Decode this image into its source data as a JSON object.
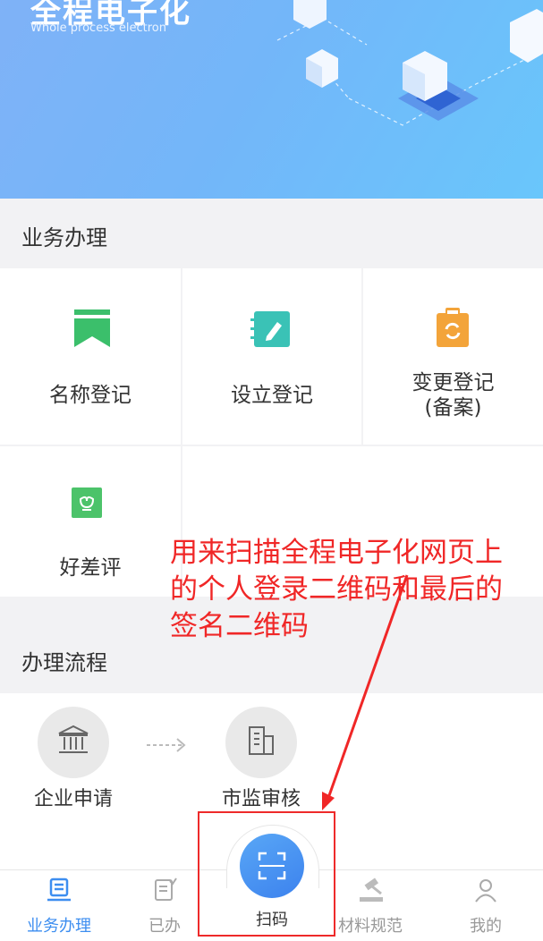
{
  "banner": {
    "title": "全程电子化",
    "subtitle": "Whole process electron"
  },
  "business": {
    "heading": "业务办理",
    "items": [
      {
        "label": "名称登记",
        "icon": "bookmark-icon",
        "color": "#3bbf6b"
      },
      {
        "label": "设立登记",
        "icon": "notebook-edit-icon",
        "color": "#3ac2b6"
      },
      {
        "label_line1": "变更登记",
        "label_line2": "(备案)",
        "icon": "clipboard-refresh-icon",
        "color": "#f3a43a"
      },
      {
        "label": "好差评",
        "icon": "flower-badge-icon",
        "color": "#4cc36a"
      }
    ]
  },
  "process": {
    "heading": "办理流程",
    "steps": [
      {
        "label": "企业申请",
        "icon": "government-building-icon"
      },
      {
        "label": "市监审核",
        "icon": "office-building-icon"
      }
    ]
  },
  "tabbar": {
    "tabs": [
      {
        "label": "业务办理",
        "icon": "list-document-icon",
        "active": true
      },
      {
        "label": "已办",
        "icon": "checklist-icon",
        "active": false
      },
      {
        "label": "扫码",
        "icon": "scan-icon",
        "active": false
      },
      {
        "label": "材料规范",
        "icon": "gavel-icon",
        "active": false
      },
      {
        "label": "我的",
        "icon": "person-icon",
        "active": false
      }
    ],
    "accent_color": "#3d8ef0"
  },
  "annotation": {
    "line1": "用来扫描全程电子化网页上",
    "line2": "的个人登录二维码和最后的",
    "line3": "签名二维码",
    "color": "#f02727"
  }
}
